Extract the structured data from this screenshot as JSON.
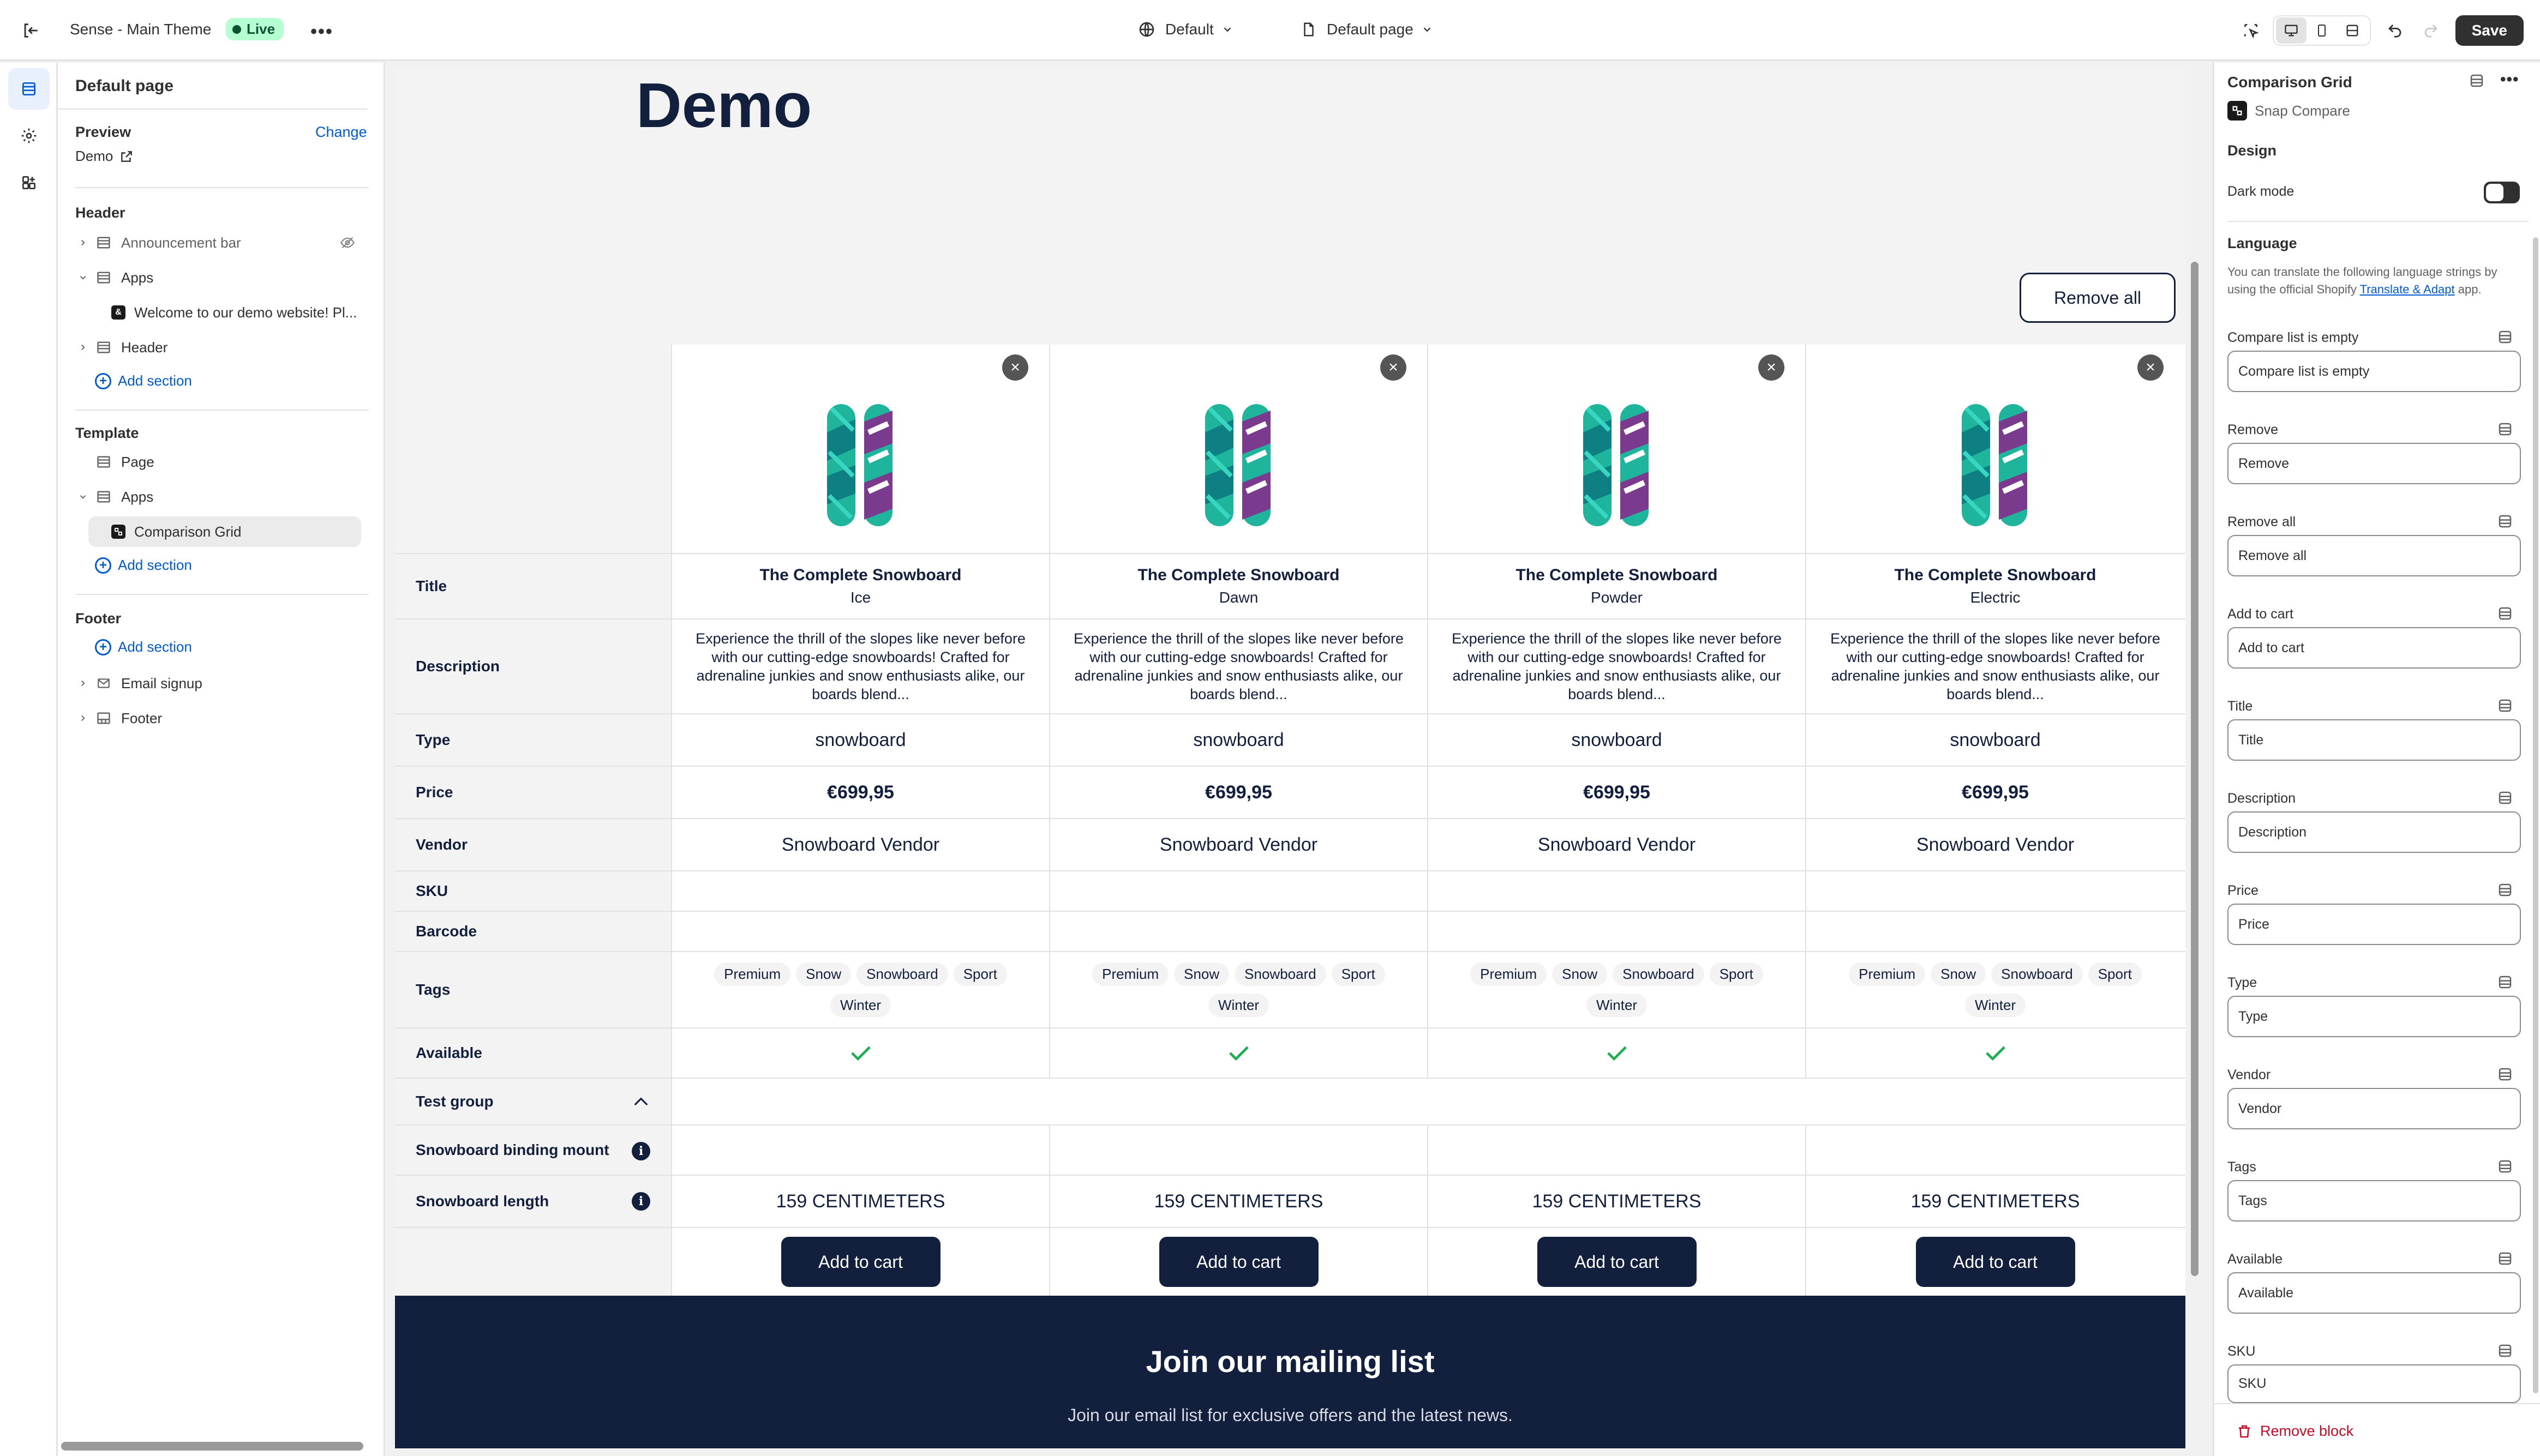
{
  "topbar": {
    "theme_name": "Sense - Main Theme",
    "live_label": "Live",
    "theme_select": "Default",
    "page_select": "Default page",
    "save_label": "Save"
  },
  "left_panel": {
    "title": "Default page",
    "preview_label": "Preview",
    "change_label": "Change",
    "preview_value": "Demo",
    "header_section": "Header",
    "announcement_bar": "Announcement bar",
    "apps_label": "Apps",
    "welcome_app": "Welcome to our demo website! Pl...",
    "header_item": "Header",
    "add_section": "Add section",
    "template_section": "Template",
    "page_item": "Page",
    "comparison_grid": "Comparison Grid",
    "footer_section": "Footer",
    "email_signup": "Email signup",
    "footer_item": "Footer"
  },
  "preview": {
    "demo_title": "Demo",
    "remove_all": "Remove all",
    "labels": {
      "title": "Title",
      "description": "Description",
      "type": "Type",
      "price": "Price",
      "vendor": "Vendor",
      "sku": "SKU",
      "barcode": "Barcode",
      "tags": "Tags",
      "available": "Available",
      "test_group": "Test group",
      "binding_mount": "Snowboard binding mount",
      "length": "Snowboard length"
    },
    "products": [
      {
        "title": "The Complete Snowboard",
        "variant": "Ice",
        "description": "Experience the thrill of the slopes like never before with our cutting-edge snowboards! Crafted for adrenaline junkies and snow enthusiasts alike, our boards blend...",
        "type": "snowboard",
        "price": "€699,95",
        "vendor": "Snowboard Vendor",
        "tags": [
          "Premium",
          "Snow",
          "Snowboard",
          "Sport",
          "Winter"
        ],
        "length": "159 CENTIMETERS",
        "add_to_cart": "Add to cart"
      },
      {
        "title": "The Complete Snowboard",
        "variant": "Dawn",
        "description": "Experience the thrill of the slopes like never before with our cutting-edge snowboards! Crafted for adrenaline junkies and snow enthusiasts alike, our boards blend...",
        "type": "snowboard",
        "price": "€699,95",
        "vendor": "Snowboard Vendor",
        "tags": [
          "Premium",
          "Snow",
          "Snowboard",
          "Sport",
          "Winter"
        ],
        "length": "159 CENTIMETERS",
        "add_to_cart": "Add to cart"
      },
      {
        "title": "The Complete Snowboard",
        "variant": "Powder",
        "description": "Experience the thrill of the slopes like never before with our cutting-edge snowboards! Crafted for adrenaline junkies and snow enthusiasts alike, our boards blend...",
        "type": "snowboard",
        "price": "€699,95",
        "vendor": "Snowboard Vendor",
        "tags": [
          "Premium",
          "Snow",
          "Snowboard",
          "Sport",
          "Winter"
        ],
        "length": "159 CENTIMETERS",
        "add_to_cart": "Add to cart"
      },
      {
        "title": "The Complete Snowboard",
        "variant": "Electric",
        "description": "Experience the thrill of the slopes like never before with our cutting-edge snowboards! Crafted for adrenaline junkies and snow enthusiasts alike, our boards blend...",
        "type": "snowboard",
        "price": "€699,95",
        "vendor": "Snowboard Vendor",
        "tags": [
          "Premium",
          "Snow",
          "Snowboard",
          "Sport",
          "Winter"
        ],
        "length": "159 CENTIMETERS",
        "add_to_cart": "Add to cart"
      }
    ],
    "mailing_title": "Join our mailing list",
    "mailing_text": "Join our email list for exclusive offers and the latest news."
  },
  "right_panel": {
    "block_title": "Comparison Grid",
    "app_name": "Snap Compare",
    "design_heading": "Design",
    "dark_mode_label": "Dark mode",
    "dark_mode_on": false,
    "language_heading": "Language",
    "help_text_1": "You can translate the following language strings by using the official Shopify ",
    "help_link": "Translate & Adapt",
    "help_text_2": " app.",
    "fields": [
      {
        "label": "Compare list is empty",
        "value": "Compare list is empty"
      },
      {
        "label": "Remove",
        "value": "Remove"
      },
      {
        "label": "Remove all",
        "value": "Remove all"
      },
      {
        "label": "Add to cart",
        "value": "Add to cart"
      },
      {
        "label": "Title",
        "value": "Title"
      },
      {
        "label": "Description",
        "value": "Description"
      },
      {
        "label": "Price",
        "value": "Price"
      },
      {
        "label": "Type",
        "value": "Type"
      },
      {
        "label": "Vendor",
        "value": "Vendor"
      },
      {
        "label": "Tags",
        "value": "Tags"
      },
      {
        "label": "Available",
        "value": "Available"
      },
      {
        "label": "SKU",
        "value": "SKU"
      }
    ],
    "remove_block": "Remove block"
  },
  "colors": {
    "brand_navy": "#121f3d",
    "link_blue": "#005bd3",
    "live_green": "#b4fed2",
    "check_green": "#1fae54",
    "remove_red": "#c70a24"
  }
}
